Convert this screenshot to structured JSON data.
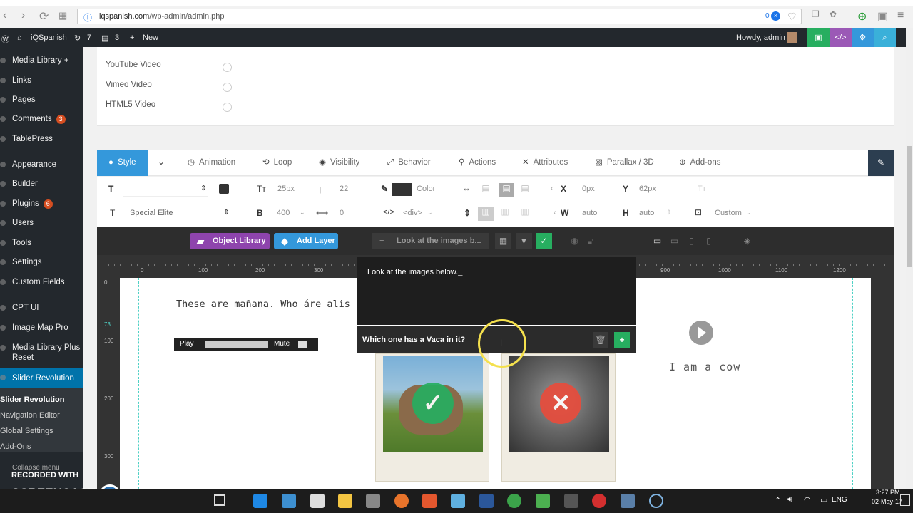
{
  "browser": {
    "url_domain": "iqspanish.com",
    "url_path": "/wp-admin/admin.php",
    "badge_count": "0"
  },
  "adminbar": {
    "site_name": "iQSpanish",
    "updates_count": "7",
    "comments_count": "3",
    "new_label": "New",
    "howdy": "Howdy, admin"
  },
  "sidebar": {
    "items": [
      {
        "label": "Media Library +"
      },
      {
        "label": "Links"
      },
      {
        "label": "Pages"
      },
      {
        "label": "Comments",
        "badge": "3"
      },
      {
        "label": "TablePress"
      },
      {
        "label": "Appearance"
      },
      {
        "label": "Builder"
      },
      {
        "label": "Plugins",
        "badge": "6"
      },
      {
        "label": "Users"
      },
      {
        "label": "Tools"
      },
      {
        "label": "Settings"
      },
      {
        "label": "Custom Fields"
      },
      {
        "label": "CPT UI"
      },
      {
        "label": "Image Map Pro"
      },
      {
        "label": "Media Library Plus Reset"
      },
      {
        "label": "Slider Revolution"
      }
    ],
    "sub_items": [
      "Slider Revolution",
      "Navigation Editor",
      "Global Settings",
      "Add-Ons"
    ],
    "collapse": "Collapse menu"
  },
  "video_options": [
    "YouTube Video",
    "Vimeo Video",
    "HTML5 Video"
  ],
  "tabs": [
    "Style",
    "Animation",
    "Loop",
    "Visibility",
    "Behavior",
    "Actions",
    "Attributes",
    "Parallax / 3D",
    "Add-ons"
  ],
  "style_row1": {
    "font_size": "25px",
    "line_height": "22",
    "color_label": "Color",
    "x_value": "0px",
    "y_value": "62px"
  },
  "style_row2": {
    "font_family": "Special Elite",
    "font_weight": "400",
    "letter_spacing": "0",
    "tag": "<div>",
    "width": "auto",
    "height": "auto",
    "custom": "Custom"
  },
  "toolbar": {
    "object_library": "Object Library",
    "add_layer": "Add Layer",
    "layer_name": "Look at the images b..."
  },
  "ruler": {
    "h_ticks": [
      "0",
      "100",
      "200",
      "300",
      "900",
      "1000",
      "1100",
      "1200"
    ],
    "v_ticks": [
      "0",
      "73",
      "100",
      "200",
      "300"
    ]
  },
  "canvas": {
    "main_text": "These are mañana. Who áre alis",
    "play": "Play",
    "mute": "Mute",
    "edit_text": "Look at the images below._",
    "question": "Which one has a Vaca in it?",
    "cow_label": "I am a cow"
  },
  "watermark": {
    "line1": "RECORDED WITH",
    "line2": "SCREENCAST",
    "line3": "MATIC"
  },
  "taskbar": {
    "lang": "ENG",
    "time": "3:27 PM",
    "date": "02-May-17"
  }
}
